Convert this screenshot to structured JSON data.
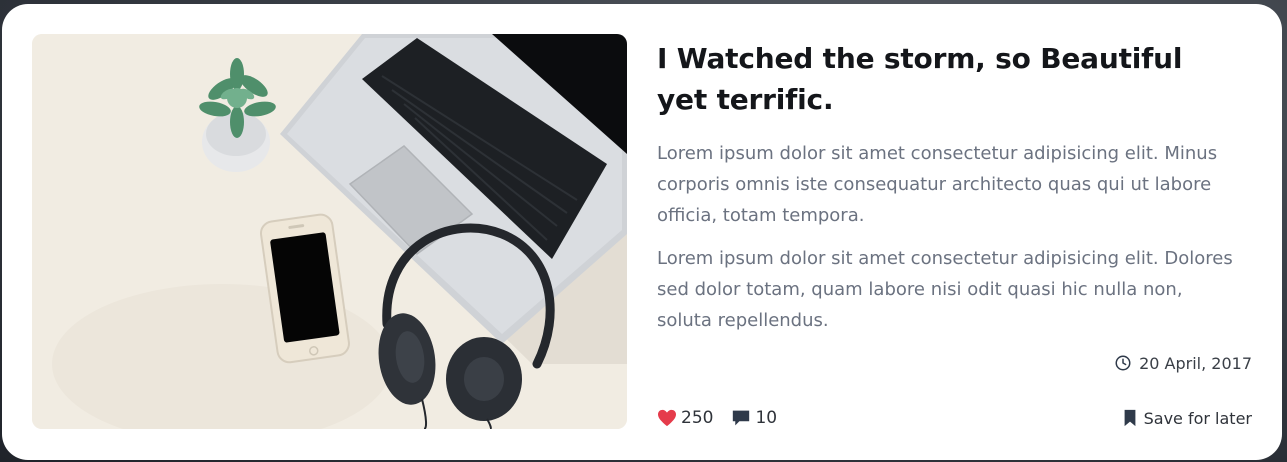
{
  "article": {
    "title": "I Watched the storm, so Beautiful yet terrific.",
    "paragraphs": [
      "Lorem ipsum dolor sit amet consectetur adipisicing elit. Minus corporis omnis iste consequatur architecto quas qui ut labore officia, totam tempora.",
      "Lorem ipsum dolor sit amet consectetur adipisicing elit. Dolores sed dolor totam, quam labore nisi odit quasi hic nulla non, soluta repellendus."
    ],
    "date": "20 April, 2017",
    "likes": "250",
    "comments": "10",
    "save_label": "Save for later"
  },
  "icons": {
    "date": "clock-icon",
    "likes": "heart-icon",
    "comments": "comment-icon",
    "save": "bookmark-icon"
  },
  "colors": {
    "heart": "#e53b4b",
    "icon_dark": "#2f3a4a",
    "text_muted": "#6b7280",
    "title": "#14161a"
  }
}
